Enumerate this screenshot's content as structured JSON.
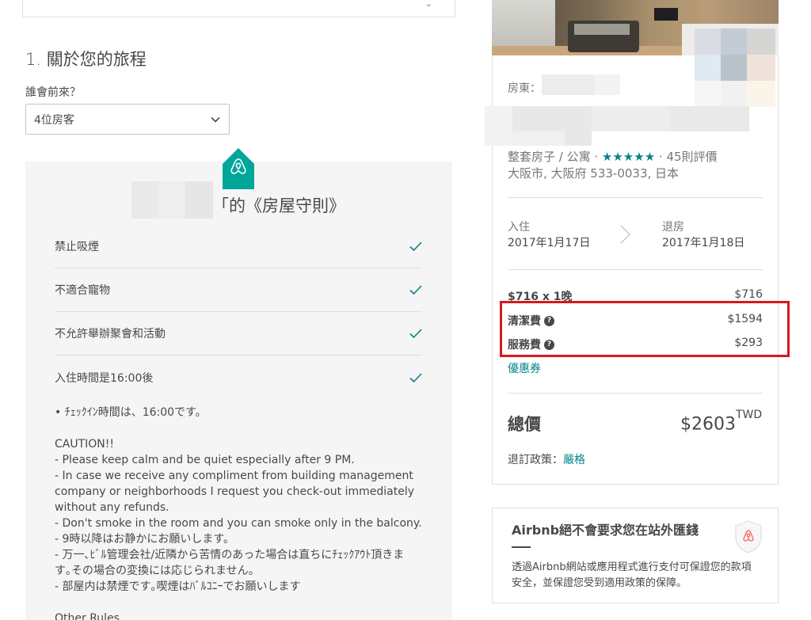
{
  "trip": {
    "step_title": "1. 關於您的旅程",
    "guests_label": "誰會前來？",
    "guests_value": "4位房客"
  },
  "house_rules": {
    "title": "「的《房屋守則》",
    "rules": [
      {
        "label": "禁止吸煙"
      },
      {
        "label": "不適合寵物"
      },
      {
        "label": "不允許舉辦聚會和活動"
      },
      {
        "label": "入住時間是16:00後"
      }
    ],
    "note_checkin": "• ﾁｪｯｸｲﾝ時間は、16:00です。",
    "caution_lines": [
      "CAUTION!!",
      "- Please keep calm and be quiet especially after 9 PM.",
      "- In case we receive any compliment from building management",
      "company or neighborhoods I request you check-out immediately",
      "without any refunds.",
      "- Don't smoke in the room and you can smoke only in the balcony.",
      "- 9時以降はお静かにお願いします。",
      "- 万一､ﾋﾞﾙ管理会社/近隣から苦情のあった場合は直ちにﾁｪｯｸｱｳﾄ頂きま",
      "す｡その場合の変換には応じられません。",
      "- 部屋内は禁煙です｡喫煙はﾊﾞﾙｺﾆｰでお願いします"
    ],
    "other_rules_heading": "Other Rules"
  },
  "listing": {
    "host_label": "房東：",
    "type_text": "整套房子 / 公寓 · ",
    "stars": "★★★★★",
    "rating": 4.5,
    "reviews_text": " · 45則評價",
    "address": "大阪市, 大阪府 533-0033, 日本"
  },
  "dates": {
    "checkin_label": "入住",
    "checkin_date": "2017年1月17日",
    "checkout_label": "退房",
    "checkout_date": "2017年1月18日"
  },
  "pricing": {
    "nightly_label": "$716 x 1晚",
    "nightly_value": "$716",
    "cleaning_label": "清潔費",
    "cleaning_value": "$1594",
    "service_label": "服務費",
    "service_value": "$293",
    "coupon_label": "優惠券",
    "total_label": "總價",
    "total_value": "$2603",
    "total_currency": "TWD",
    "policy_label": "退訂政策：",
    "policy_value": "嚴格",
    "highlight_color": "#d7191c"
  },
  "trust": {
    "title": "Airbnb絕不會要求您在站外匯錢",
    "body": "透過Airbnb網站或應用程式進行支付可保證您的款項安全，並保證您受到適用政策的保障。"
  },
  "colors": {
    "brand_teal": "#008489",
    "logo_teal": "#00a699",
    "text": "#484848",
    "muted": "#767676",
    "divider": "#dce0e0"
  },
  "icons": {
    "select_chevron": "chevron-down-icon",
    "rule_check": "check-icon",
    "date_arrow": "chevron-right-icon",
    "help": "question-circle-icon",
    "logo": "airbnb-logo-icon",
    "shield": "shield-icon"
  }
}
